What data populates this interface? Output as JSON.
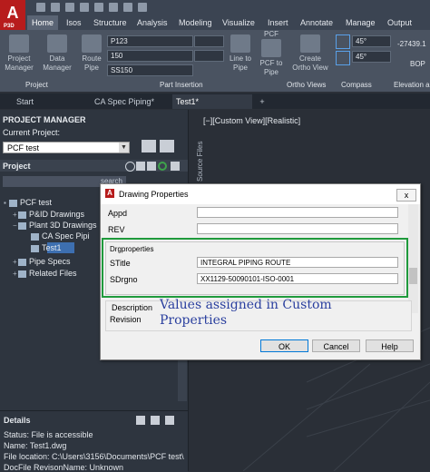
{
  "app": {
    "logo": "A",
    "logo_sub": "P3D"
  },
  "ribbon_tabs": [
    "Home",
    "Isos",
    "Structure",
    "Analysis",
    "Modeling",
    "Visualize",
    "Insert",
    "Annotate",
    "Manage",
    "Output"
  ],
  "ribbon": {
    "project_panel": {
      "label": "Project",
      "buttons": [
        {
          "line1": "Project",
          "line2": "Manager"
        },
        {
          "line1": "Data",
          "line2": "Manager"
        }
      ]
    },
    "part_insertion_panel": {
      "label": "Part Insertion",
      "route_pipe": {
        "line1": "Route",
        "line2": "Pipe"
      },
      "spec": "P123",
      "size": "150",
      "pipe_spec": "SS150",
      "line_to_pipe": {
        "line1": "Line to",
        "line2": "Pipe"
      },
      "pcf_to_pipe": {
        "line1": "PCF to",
        "line2": "Pipe"
      },
      "pcf_label": "PCF"
    },
    "ortho_panel": {
      "label": "Ortho Views",
      "create": {
        "line1": "Create",
        "line2": "Ortho View"
      }
    },
    "compass_panel": {
      "label": "Compass",
      "angle1": "45°",
      "angle2": "45°"
    },
    "elevation_panel": {
      "label": "Elevation a",
      "elev": "-27439.1",
      "bop": "BOP"
    }
  },
  "doc_tabs": [
    "Start",
    "CA Spec Piping*",
    "Test1*"
  ],
  "new_tab_label": "+",
  "project_manager": {
    "title": "PROJECT MANAGER",
    "current_project_label": "Current Project:",
    "current_project": "PCF test",
    "project_label": "Project",
    "search_placeholder": "search",
    "tree": [
      {
        "label": "PCF test",
        "level": 0
      },
      {
        "label": "P&ID Drawings",
        "level": 1
      },
      {
        "label": "Plant 3D Drawings",
        "level": 1
      },
      {
        "label": "CA Spec Pipi",
        "level": 2
      },
      {
        "label": "Test1",
        "level": 2
      },
      {
        "label": "Pipe Specs",
        "level": 1
      },
      {
        "label": "Related Files",
        "level": 1
      }
    ],
    "source_files": "Source Files",
    "details_title": "Details",
    "details": [
      "Status: File is accessible",
      "Name: Test1.dwg",
      "File location: C:\\Users\\3156\\Documents\\PCF test\\",
      "DocFile RevisonName: Unknown"
    ]
  },
  "viewport_label": "[−][Custom View][Realistic]",
  "dialog": {
    "title": "Drawing Properties",
    "close": "x",
    "fields_top": [
      {
        "label": "Appd",
        "value": ""
      },
      {
        "label": "REV",
        "value": ""
      }
    ],
    "group_title": "Drgproperties",
    "group_fields": [
      {
        "label": "STitle",
        "value": "INTEGRAL PIPING ROUTE"
      },
      {
        "label": "SDrgno",
        "value": "XX1129-50090101-ISO-0001"
      }
    ],
    "desc_label": "Description",
    "revision_label": "Revision",
    "annotation": "Values assigned in Custom Properties",
    "buttons": {
      "ok": "OK",
      "cancel": "Cancel",
      "help": "Help"
    }
  }
}
